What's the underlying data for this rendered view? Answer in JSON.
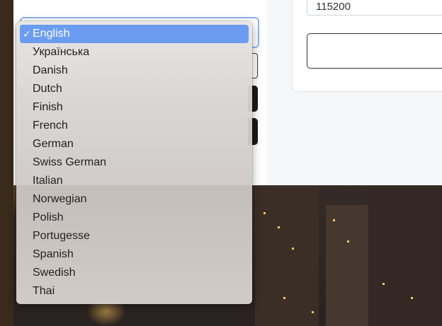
{
  "form": {
    "baud_rate_value": "115200",
    "language_selected": "English"
  },
  "dropdown": {
    "check_mark": "✓",
    "options": [
      "English",
      "Українська",
      "Danish",
      "Dutch",
      "Finish",
      "French",
      "German",
      "Swiss German",
      "Italian",
      "Norwegian",
      "Polish",
      "Portugesse",
      "Spanish",
      "Swedish",
      "Thai"
    ]
  },
  "colors": {
    "selection_highlight": "#6b9cf2",
    "focus_ring": "#8db5f2",
    "dark_button": "#1b1b1b"
  }
}
